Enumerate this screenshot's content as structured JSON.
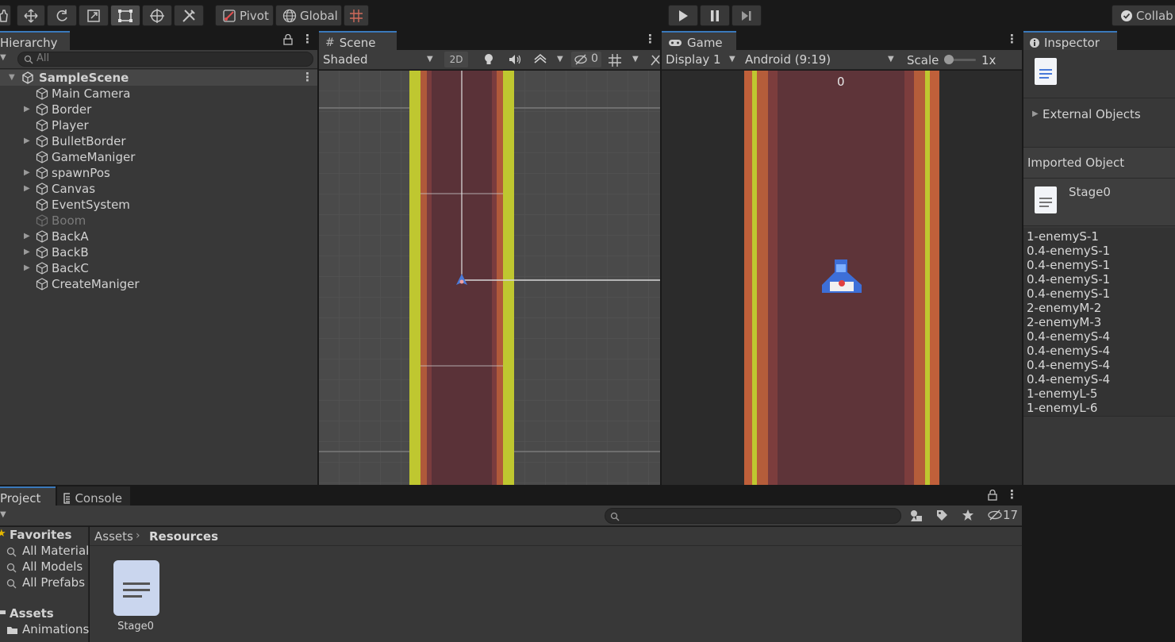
{
  "toolbar": {
    "pivot": "Pivot",
    "global": "Global",
    "collab": "Collab"
  },
  "hierarchy": {
    "tab": "Hierarchy",
    "search_placeholder": "All",
    "scene": "SampleScene",
    "items": [
      {
        "label": "Main Camera",
        "expandable": false,
        "disabled": false
      },
      {
        "label": "Border",
        "expandable": true,
        "disabled": false
      },
      {
        "label": "Player",
        "expandable": false,
        "disabled": false
      },
      {
        "label": "BulletBorder",
        "expandable": true,
        "disabled": false
      },
      {
        "label": "GameManiger",
        "expandable": false,
        "disabled": false
      },
      {
        "label": "spawnPos",
        "expandable": true,
        "disabled": false
      },
      {
        "label": "Canvas",
        "expandable": true,
        "disabled": false
      },
      {
        "label": "EventSystem",
        "expandable": false,
        "disabled": false
      },
      {
        "label": "Boom",
        "expandable": false,
        "disabled": true
      },
      {
        "label": "BackA",
        "expandable": true,
        "disabled": false
      },
      {
        "label": "BackB",
        "expandable": true,
        "disabled": false
      },
      {
        "label": "BackC",
        "expandable": true,
        "disabled": false
      },
      {
        "label": "CreateManiger",
        "expandable": false,
        "disabled": false
      }
    ]
  },
  "scene": {
    "tab": "Scene",
    "shading": "Shaded",
    "mode_2d": "2D",
    "hidden_count": "0"
  },
  "game": {
    "tab": "Game",
    "display": "Display 1",
    "resolution": "Android (9:19)",
    "scale_label": "Scale",
    "scale_value": "1x",
    "score": "0"
  },
  "inspector": {
    "tab": "Inspector",
    "external_objects": "External Objects",
    "imported_object": "Imported Object",
    "asset_name": "Stage0",
    "content_lines": [
      "1-enemyS-1",
      "0.4-enemyS-1",
      "0.4-enemyS-1",
      "0.4-enemyS-1",
      "0.4-enemyS-1",
      "2-enemyM-2",
      "2-enemyM-3",
      "0.4-enemyS-4",
      "0.4-enemyS-4",
      "0.4-enemyS-4",
      "0.4-enemyS-4",
      "1-enemyL-5",
      "1-enemyL-6"
    ]
  },
  "project": {
    "tab_project": "Project",
    "tab_console": "Console",
    "hidden_count": "17",
    "favorites_label": "Favorites",
    "favorites": [
      "All Material:",
      "All Models",
      "All Prefabs"
    ],
    "assets_label": "Assets",
    "assets_children": [
      "Animations"
    ],
    "breadcrumb_root": "Assets",
    "breadcrumb_current": "Resources",
    "files": [
      {
        "name": "Stage0"
      }
    ]
  },
  "colors": {
    "accent": "#3a79bb",
    "road": "#5e3439",
    "grass": "#bfc730",
    "edge_orange": "#c0603a"
  }
}
